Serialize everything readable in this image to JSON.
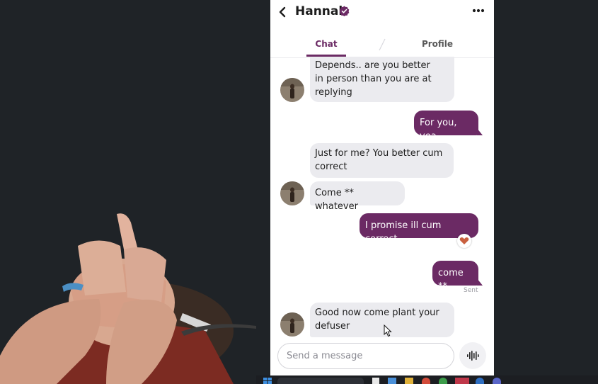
{
  "header": {
    "contact_name": "Hannah",
    "verified": true
  },
  "tabs": [
    {
      "label": "Chat",
      "active": true
    },
    {
      "label": "Profile",
      "active": false
    }
  ],
  "messages": [
    {
      "direction": "incoming",
      "lines": [
        "Depends.. are you better",
        "in person than you are at",
        "replying"
      ],
      "avatar": true
    },
    {
      "direction": "outgoing",
      "lines": [
        "For you, yea"
      ]
    },
    {
      "direction": "incoming",
      "lines": [
        "Just for me? You better cum",
        "correct"
      ],
      "avatar": false
    },
    {
      "direction": "incoming",
      "lines": [
        "Come ** whatever"
      ],
      "avatar": true
    },
    {
      "direction": "outgoing",
      "lines": [
        "I promise ill cum correct"
      ],
      "reaction": "heart"
    },
    {
      "direction": "outgoing",
      "lines": [
        "come **"
      ],
      "status": "Sent"
    },
    {
      "direction": "incoming",
      "lines": [
        "Good now come plant your",
        "defuser"
      ],
      "avatar": true
    }
  ],
  "composer": {
    "placeholder": "Send a message"
  },
  "colors": {
    "accent": "#6b2a64",
    "incoming_bubble": "#ebebef",
    "background": "#1f2327"
  },
  "icons": [
    "back-arrow-icon",
    "verified-badge-icon",
    "more-options-icon",
    "heart-icon",
    "voice-waveform-icon",
    "cursor-icon",
    "windows-start-icon"
  ]
}
